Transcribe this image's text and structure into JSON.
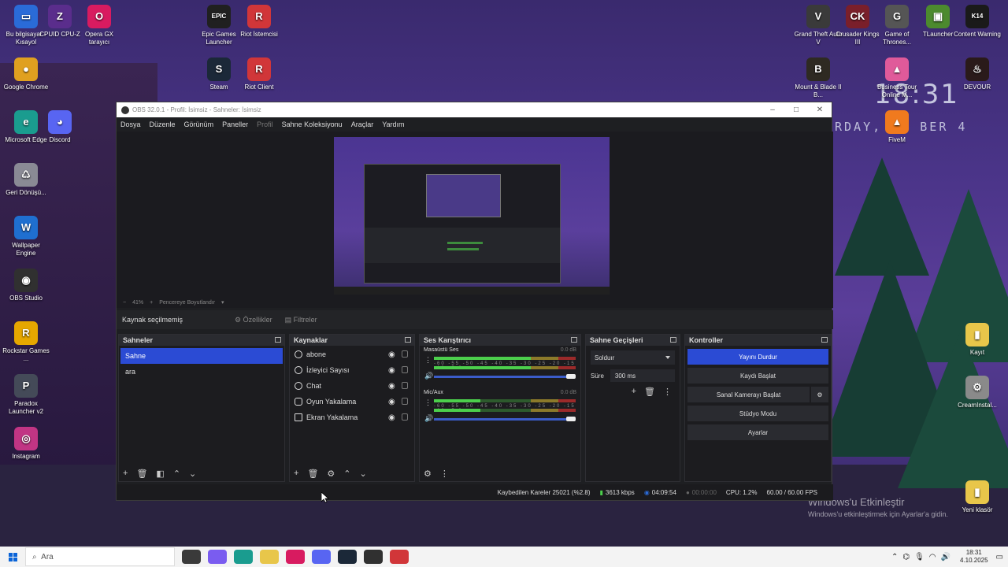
{
  "desktop": {
    "icons_left": [
      {
        "label": "Bu bilgisayar - Kısayol",
        "glyph": "▭",
        "color": "#2a6bd8"
      },
      {
        "label": "CPUID CPU-Z",
        "glyph": "Z",
        "color": "#5a2d8c"
      },
      {
        "label": "Opera GX tarayıcı",
        "glyph": "O",
        "color": "#d81b60"
      },
      {
        "label": "Google Chrome",
        "glyph": "●",
        "color": "#e0a020"
      },
      {
        "label": "Discord",
        "glyph": "◕",
        "color": "#5865f2"
      },
      {
        "label": "Microsoft Edge",
        "glyph": "e",
        "color": "#1a9c8f"
      },
      {
        "label": "Geri Dönüşü...",
        "glyph": "♺",
        "color": "#8a8a95"
      },
      {
        "label": "Wallpaper Engine",
        "glyph": "W",
        "color": "#1f6fd0"
      },
      {
        "label": "OBS Studio",
        "glyph": "◉",
        "color": "#303030"
      },
      {
        "label": "Rockstar Games ...",
        "glyph": "R",
        "color": "#e6a700"
      },
      {
        "label": "Paradox Launcher v2",
        "glyph": "P",
        "color": "#444a58"
      },
      {
        "label": "Instagram",
        "glyph": "◎",
        "color": "#c13584"
      },
      {
        "label": "Epic Games Launcher",
        "glyph": "EPIC",
        "color": "#202020"
      },
      {
        "label": "Riot İstemcisi",
        "glyph": "R",
        "color": "#d13639"
      },
      {
        "label": "Steam",
        "glyph": "S",
        "color": "#1b2838"
      },
      {
        "label": "Riot Client",
        "glyph": "R",
        "color": "#d13639"
      }
    ],
    "icons_right": [
      {
        "label": "Grand Theft Auto V",
        "glyph": "V",
        "color": "#3a3a3a"
      },
      {
        "label": "Crusader Kings III",
        "glyph": "CK",
        "color": "#7a1f2a"
      },
      {
        "label": "Game of Thrones...",
        "glyph": "G",
        "color": "#555555"
      },
      {
        "label": "TLauncher",
        "glyph": "▣",
        "color": "#4c8a2e"
      },
      {
        "label": "Content Warning",
        "glyph": "K14",
        "color": "#1a1a1a"
      },
      {
        "label": "Mount & Blade II B...",
        "glyph": "B",
        "color": "#2e2a22"
      },
      {
        "label": "Business Tour Online M...",
        "glyph": "▲",
        "color": "#e05a9a"
      },
      {
        "label": "DEVOUR",
        "glyph": "♨",
        "color": "#2a1a1a"
      },
      {
        "label": "FiveM",
        "glyph": "▲",
        "color": "#f07a1e"
      },
      {
        "label": "Kayıt",
        "glyph": "▮",
        "color": "#e8c64a"
      },
      {
        "label": "CreamInstal...",
        "glyph": "⚙",
        "color": "#8a8a8a"
      },
      {
        "label": "Yeni klasör",
        "glyph": "▮",
        "color": "#e8c64a"
      }
    ],
    "clock_widget": {
      "time": "18:31",
      "date": "RDAY, OC  BER 4"
    },
    "activation": {
      "title": "Windows'u Etkinleştir",
      "subtitle": "Windows'u etkinleştirmek için Ayarlar'a gidin."
    }
  },
  "obs": {
    "title": "OBS 32.0.1 - Profil: İsimsiz - Sahneler: İsimsiz",
    "window_buttons": {
      "minimize": "–",
      "maximize": "□",
      "close": "✕"
    },
    "menu": [
      "Dosya",
      "Düzenle",
      "Görünüm",
      "Paneller",
      "Profil",
      "Sahne Koleksiyonu",
      "Araçlar",
      "Yardım"
    ],
    "preview_bar": {
      "zoom_out": "−",
      "zoom": "41%",
      "zoom_in": "+",
      "fit": "Pencereye Boyutlandır",
      "dropdown": "▾"
    },
    "source_bar": {
      "no_selection": "Kaynak seçilmemiş",
      "properties": "Özellikler",
      "filters": "Filtreler"
    },
    "docks": {
      "scenes": {
        "title": "Sahneler",
        "items": [
          "Sahne",
          "ara"
        ],
        "selected": "Sahne"
      },
      "sources": {
        "title": "Kaynaklar",
        "items": [
          "abone",
          "İzleyici Sayısı",
          "Chat",
          "Oyun Yakalama",
          "Ekran Yakalama"
        ]
      },
      "mixer": {
        "title": "Ses Karıştırıcı",
        "channels": [
          {
            "name": "Masaüstü Ses",
            "db": "0.0 dB",
            "level": 0.86
          },
          {
            "name": "Mic/Aux",
            "db": "0.0 dB",
            "level": 0.33
          }
        ],
        "ticks": "-60 -55 -50 -45 -40 -35 -30 -25 -20 -15 -10 -5 0"
      },
      "transitions": {
        "title": "Sahne Geçişleri",
        "selected": "Solduır",
        "duration_label": "Süre",
        "duration_value": "300 ms"
      },
      "controls": {
        "title": "Kontroller",
        "buttons": [
          "Yayını Durdur",
          "Kaydı Başlat",
          "Sanal Kamerayı Başlat",
          "Stüdyo Modu",
          "Ayarlar"
        ]
      }
    },
    "status": {
      "dropped": "Kaybedilen Kareler 25021 (%2.8)",
      "bitrate": "3613 kbps",
      "stream_time": "04:09:54",
      "rec_time": "00:00:00",
      "cpu": "CPU: 1.2%",
      "fps": "60.00 / 60.00 FPS"
    }
  },
  "taskbar": {
    "search_placeholder": "Ara",
    "apps": [
      {
        "name": "task-view",
        "color": "#3a3a3a"
      },
      {
        "name": "copilot",
        "color": "#7a5cf0"
      },
      {
        "name": "edge",
        "color": "#1a9c8f"
      },
      {
        "name": "explorer",
        "color": "#e8c64a"
      },
      {
        "name": "opera-gx",
        "color": "#d81b60"
      },
      {
        "name": "discord",
        "color": "#5865f2"
      },
      {
        "name": "steam",
        "color": "#1b2838"
      },
      {
        "name": "obs",
        "color": "#303030"
      },
      {
        "name": "riot",
        "color": "#d13639"
      }
    ],
    "time": "18:31",
    "date": "4.10.2025"
  }
}
